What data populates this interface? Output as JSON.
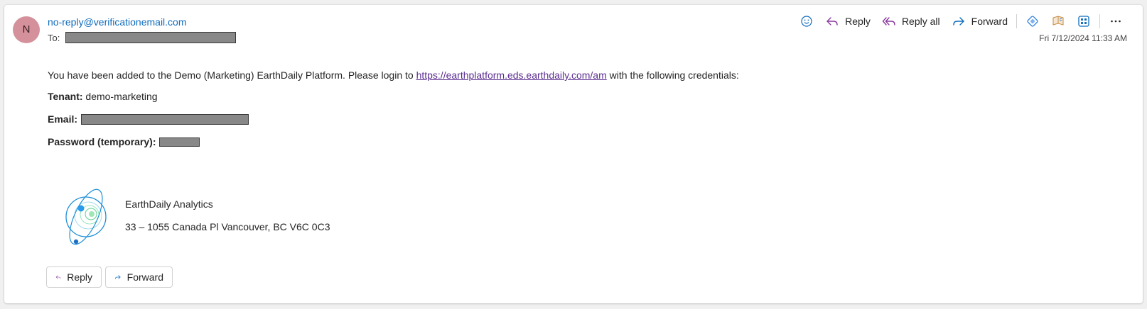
{
  "sender": {
    "avatar_initial": "N",
    "email": "no-reply@verificationemail.com"
  },
  "recipient": {
    "label": "To:"
  },
  "date": "Fri 7/12/2024 11:33 AM",
  "toolbar": {
    "reply_label": "Reply",
    "reply_all_label": "Reply all",
    "forward_label": "Forward",
    "icons": [
      "emoji-icon",
      "reply-icon",
      "reply-all-icon",
      "forward-icon",
      "loop-icon",
      "immersive-reader-icon",
      "apps-icon",
      "more-icon"
    ]
  },
  "body": {
    "intro_before": "You have been added to the Demo (Marketing) EarthDaily Platform. Please login to ",
    "link": "https://earthplatform.eds.earthdaily.com/am",
    "intro_after": " with the following credentials:",
    "tenant_label": "Tenant:",
    "tenant_value": " demo-marketing",
    "email_label": "Email:",
    "password_label": "Password (temporary):"
  },
  "signature": {
    "company": "EarthDaily Analytics",
    "address": "33 – 1055 Canada Pl Vancouver, BC V6C 0C3"
  },
  "footer": {
    "reply_label": "Reply",
    "forward_label": "Forward"
  },
  "colors": {
    "accent": "#0f6cbd",
    "link": "#5b2e91",
    "avatar": "#d4919b",
    "reply_icon": "#8a3a9e"
  }
}
